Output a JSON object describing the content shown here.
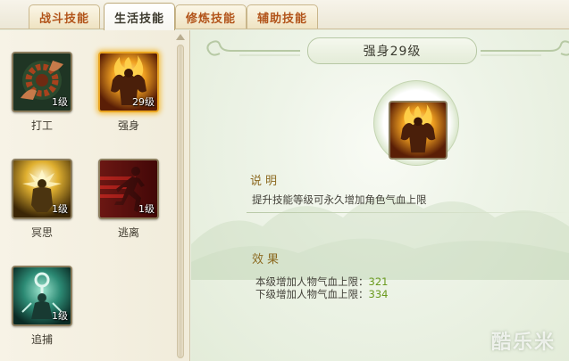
{
  "tabs": [
    {
      "label": "战斗技能",
      "active": false
    },
    {
      "label": "生活技能",
      "active": true
    },
    {
      "label": "修炼技能",
      "active": false
    },
    {
      "label": "辅助技能",
      "active": false
    }
  ],
  "skills": [
    {
      "name": "打工",
      "level": "1级",
      "icon": "gear-hands-icon",
      "selected": false
    },
    {
      "name": "强身",
      "level": "29级",
      "icon": "flaming-muscle-icon",
      "selected": true
    },
    {
      "name": "冥思",
      "level": "1级",
      "icon": "meditation-glow-icon",
      "selected": false
    },
    {
      "name": "逃离",
      "level": "1级",
      "icon": "running-figure-icon",
      "selected": false
    },
    {
      "name": "追捕",
      "level": "1级",
      "icon": "chain-capture-icon",
      "selected": false
    }
  ],
  "detail": {
    "title": "强身29级",
    "icon": "flaming-muscle-icon",
    "desc_heading": "说明",
    "description": "提升技能等级可永久增加角色气血上限",
    "effect_heading": "效果",
    "current_label": "本级增加人物气血上限：",
    "current_value": "321",
    "next_label": "下级增加人物气血上限：",
    "next_value": "334"
  },
  "watermark": "酷乐米",
  "colors": {
    "tab_text": "#b2541a",
    "selected_glow": "#f2c04d",
    "section_heading": "#8c6a21",
    "value_green": "#6a9a1e"
  }
}
